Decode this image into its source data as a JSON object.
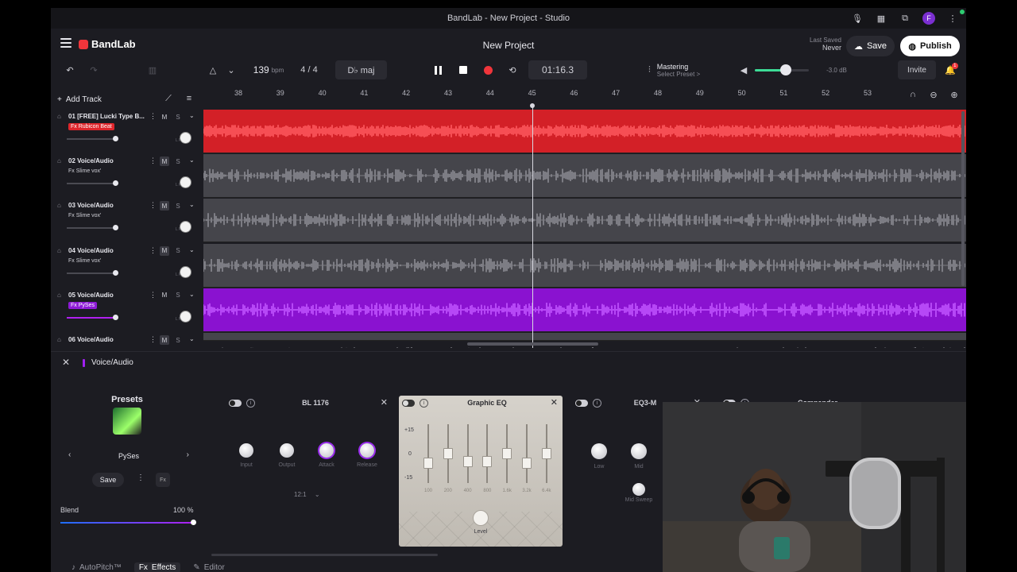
{
  "window": {
    "title": "BandLab - New Project - Studio"
  },
  "header": {
    "brand": "BandLab",
    "project_title": "New Project",
    "last_saved_label": "Last Saved",
    "last_saved_value": "Never",
    "save_label": "Save",
    "publish_label": "Publish"
  },
  "transport": {
    "bpm": "139",
    "bpm_unit": "bpm",
    "time_signature": "4 / 4",
    "key": "D♭ maj",
    "time": "01:16.3",
    "mastering_title": "Mastering",
    "mastering_preset": "Select Preset >",
    "volume_db": "-3.0 dB",
    "volume_level": 0.5,
    "invite_label": "Invite",
    "notification_count": "1"
  },
  "tracks_toolbar": {
    "add_track_label": "Add Track"
  },
  "ruler": [
    "38",
    "39",
    "40",
    "41",
    "42",
    "43",
    "44",
    "45",
    "46",
    "47",
    "48",
    "49",
    "50",
    "51",
    "52",
    "53"
  ],
  "tracks": [
    {
      "number": "01",
      "name": "[FREE] Lucki Type B...",
      "fx": "Fx Rubicon Beat",
      "color": "#e0262c",
      "mute": "M",
      "solo": "S"
    },
    {
      "number": "02",
      "name": "Voice/Audio",
      "fx": "Fx Slime vox'",
      "color": "#5a5a60",
      "mute": "M",
      "solo": "S"
    },
    {
      "number": "03",
      "name": "Voice/Audio",
      "fx": "Fx Slime vox'",
      "color": "#5a5a60",
      "mute": "M",
      "solo": "S"
    },
    {
      "number": "04",
      "name": "Voice/Audio",
      "fx": "Fx Slime vox'",
      "color": "#5a5a60",
      "mute": "M",
      "solo": "S"
    },
    {
      "number": "05",
      "name": "Voice/Audio",
      "fx": "Fx PySes",
      "color": "#8e1bd6",
      "mute": "M",
      "solo": "S"
    },
    {
      "number": "06",
      "name": "Voice/Audio",
      "fx": "",
      "color": "#5a5a60",
      "mute": "M",
      "solo": "S"
    }
  ],
  "fx_panel": {
    "track_name": "Voice/Audio",
    "presets_title": "Presets",
    "preset_name": "PySes",
    "preset_save": "Save",
    "blend_label": "Blend",
    "blend_value": "100 %",
    "plugins": {
      "bl1176": {
        "name": "BL 1176",
        "knobs": [
          "Input",
          "Output",
          "Attack",
          "Release"
        ],
        "ratio": "12:1"
      },
      "graphic_eq": {
        "name": "Graphic EQ",
        "db_labels": [
          "+15",
          "0",
          "-15"
        ],
        "bands": [
          "100",
          "200",
          "400",
          "800",
          "1.6k",
          "3.2k",
          "6.4k"
        ],
        "level_label": "Level"
      },
      "eq3m": {
        "name": "EQ3-M",
        "knobs": [
          "Low",
          "Mid",
          "Mid Sweep"
        ]
      },
      "compander": {
        "name": "Compander"
      }
    }
  },
  "bottom_tabs": {
    "autopitch": "AutoPitch™",
    "effects": "Effects",
    "editor": "Editor"
  },
  "colors": {
    "accent_red": "#f0353b",
    "accent_purple": "#9b2cf0",
    "accent_green": "#3ddc97"
  }
}
